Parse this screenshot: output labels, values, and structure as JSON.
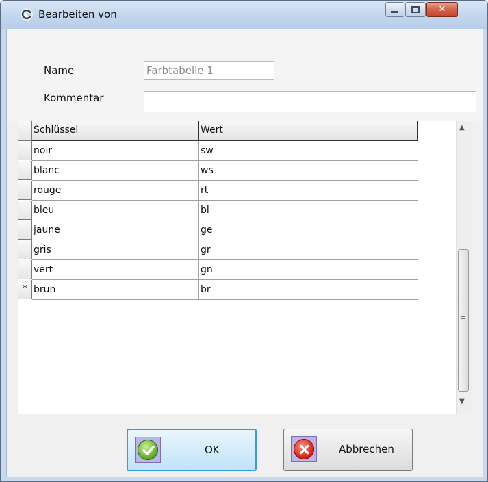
{
  "window": {
    "title": "Bearbeiten von",
    "minimize_icon": "minimize-icon",
    "maximize_icon": "maximize-icon",
    "close_symbol": "✕"
  },
  "form": {
    "name_label": "Name",
    "name_value": "Farbtabelle 1",
    "comment_label": "Kommentar",
    "comment_value": ""
  },
  "grid": {
    "columns": [
      "Schlüssel",
      "Wert"
    ],
    "new_row_marker": "*",
    "rows": [
      {
        "key": "noir",
        "value": "sw"
      },
      {
        "key": "blanc",
        "value": "ws"
      },
      {
        "key": "rouge",
        "value": "rt"
      },
      {
        "key": "bleu",
        "value": "bl"
      },
      {
        "key": "jaune",
        "value": "ge"
      },
      {
        "key": "gris",
        "value": "gr"
      },
      {
        "key": "vert",
        "value": "gn"
      },
      {
        "key": "brun",
        "value": "br"
      }
    ]
  },
  "buttons": {
    "ok_label": "OK",
    "cancel_label": "Abbrechen",
    "ok_icon": "checkmark-icon",
    "cancel_icon": "cross-icon"
  },
  "colors": {
    "ok_border": "#3c9ad8",
    "ok_icon": "#63ad2a",
    "cancel_icon": "#d9271a",
    "titlebar": "#c3d6ee"
  }
}
